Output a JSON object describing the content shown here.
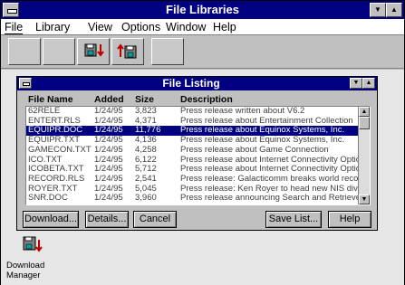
{
  "app": {
    "title": "File Libraries",
    "min_glyph": "▼",
    "max_glyph": "▲"
  },
  "menu": [
    {
      "label": "File"
    },
    {
      "label": "Library"
    },
    {
      "label": "View"
    },
    {
      "label": "Options"
    },
    {
      "label": "Window"
    },
    {
      "label": "Help"
    }
  ],
  "toolbar": {
    "buttons": [
      {
        "icon": "blank-disabled-icon"
      },
      {
        "icon": "blank-disabled-icon"
      },
      {
        "icon": "download-icon"
      },
      {
        "icon": "upload-icon"
      },
      {
        "icon": "blank-disabled-icon"
      }
    ]
  },
  "listing": {
    "title": "File Listing",
    "min_glyph": "▼",
    "max_glyph": "▲",
    "columns": [
      "File Name",
      "Added",
      "Size",
      "Description"
    ],
    "rows": [
      {
        "name": "62RELE",
        "added": "1/24/95",
        "size": "3,823",
        "desc": "Press release written about V6.2"
      },
      {
        "name": "ENTERT.RLS",
        "added": "1/24/95",
        "size": "4,371",
        "desc": "Press release about Entertainment Collection"
      },
      {
        "name": "EQUIPR.DOC",
        "added": "1/24/95",
        "size": "11,776",
        "desc": "Press release about Equinox Systems, Inc.",
        "selected": true
      },
      {
        "name": "EQUIPR.TXT",
        "added": "1/24/95",
        "size": "4,136",
        "desc": "Press release about Equinox Systems, Inc."
      },
      {
        "name": "GAMECON.TXT",
        "added": "1/24/95",
        "size": "4,258",
        "desc": "Press release about Game Connection"
      },
      {
        "name": "ICO.TXT",
        "added": "1/24/95",
        "size": "6,122",
        "desc": "Press release about Internet Connectivity Option"
      },
      {
        "name": "ICOBETA.TXT",
        "added": "1/24/95",
        "size": "5,712",
        "desc": "Press release about Internet Connectivity Option"
      },
      {
        "name": "RECORD.RLS",
        "added": "1/24/95",
        "size": "2,541",
        "desc": "Press release:  Galacticomm breaks world record"
      },
      {
        "name": "ROYER.TXT",
        "added": "1/24/95",
        "size": "5,045",
        "desc": "Press release: Ken Royer to head new NIS division"
      },
      {
        "name": "SNR.DOC",
        "added": "1/24/95",
        "size": "3,960",
        "desc": "Press release announcing Search and Retrieve"
      }
    ],
    "buttons": {
      "download": "Download...",
      "details": "Details...",
      "cancel": "Cancel",
      "save_list": "Save List...",
      "help": "Help"
    },
    "scroll": {
      "up": "▲",
      "down": "▼"
    }
  },
  "desktop_icon": {
    "line1": "Download",
    "line2": "Manager"
  },
  "colors": {
    "titlebar": "#000080",
    "window_face": "#c0c0c0",
    "selection": "#000080"
  }
}
